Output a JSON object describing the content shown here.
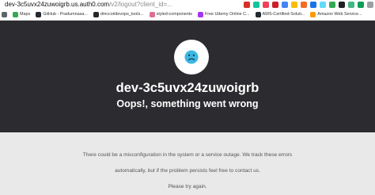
{
  "browser": {
    "url_host": "dev-3c5uvx24zuwoigrb.us.auth0.com",
    "url_path": "/v2/logout?client_id=...",
    "extensions": [
      {
        "name": "ext-mail-icon",
        "color": "#d93025"
      },
      {
        "name": "ext-grammar-icon",
        "color": "#15c39a"
      },
      {
        "name": "ext-pocket-icon",
        "color": "#ef4056"
      },
      {
        "name": "ext-lastpass-icon",
        "color": "#cc2029"
      },
      {
        "name": "ext-calendar-icon",
        "color": "#4285f4"
      },
      {
        "name": "ext-notes-icon",
        "color": "#fbbc04"
      },
      {
        "name": "ext-honey-icon",
        "color": "#f26c23"
      },
      {
        "name": "ext-translate-icon",
        "color": "#1a73e8"
      },
      {
        "name": "ext-react-icon",
        "color": "#61dafb"
      },
      {
        "name": "ext-shield-icon",
        "color": "#34a853"
      },
      {
        "name": "ext-dark-icon",
        "color": "#202124"
      },
      {
        "name": "ext-vue-icon",
        "color": "#42b883"
      },
      {
        "name": "ext-json-icon",
        "color": "#0f9d58"
      },
      {
        "name": "ext-puzzle-icon",
        "color": "#9aa0a6"
      }
    ],
    "bookmarks": [
      {
        "label": "",
        "icon": "apps-icon",
        "color": "#5f6368"
      },
      {
        "label": "Maps",
        "icon": "maps-icon",
        "color": "#34a853"
      },
      {
        "label": "GitHub - Pradumnasa...",
        "icon": "github-icon",
        "color": "#24292e"
      },
      {
        "label": "dmccoi/devops_tools...",
        "icon": "github-icon",
        "color": "#24292e"
      },
      {
        "label": "styled-components",
        "icon": "styled-components-icon",
        "color": "#db7093"
      },
      {
        "label": "Free Udemy Online C...",
        "icon": "udemy-icon",
        "color": "#a435f0"
      },
      {
        "label": "AWS-Certified-Soluti...",
        "icon": "github-icon",
        "color": "#24292e"
      },
      {
        "label": "Amazon Web Service...",
        "icon": "aws-icon",
        "color": "#ff9900"
      }
    ]
  },
  "page": {
    "tenant": "dev-3c5uvx24zuwoigrb",
    "error_title": "Oops!, something went wrong",
    "message_line_1": "There could be a misconfiguration in the system or a service outage. We track these errors",
    "message_line_2": "automatically, but if the problem persists feel free to contact us.",
    "message_line_3": "Please try again."
  },
  "colors": {
    "header_bg": "#2c2c30",
    "body_bg": "#e9e9ea",
    "sad_face": "#3db7e4"
  }
}
